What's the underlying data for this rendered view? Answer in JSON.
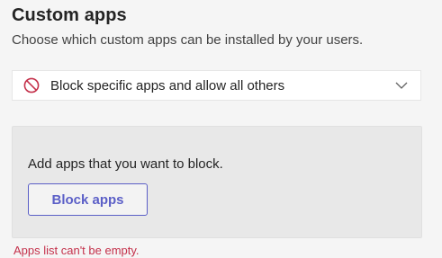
{
  "section": {
    "title": "Custom apps",
    "subtitle": "Choose which custom apps can be installed by your users."
  },
  "dropdown": {
    "selected_value": "Block specific apps and allow all others",
    "icon": "block-icon",
    "chevron_icon": "chevron-down-icon"
  },
  "panel": {
    "instruction": "Add apps that you want to block.",
    "button_label": "Block apps"
  },
  "validation": {
    "error_message": "Apps list can't be empty."
  },
  "colors": {
    "accent": "#5b5fc7",
    "error": "#c4314b",
    "block_icon": "#c4314b"
  }
}
